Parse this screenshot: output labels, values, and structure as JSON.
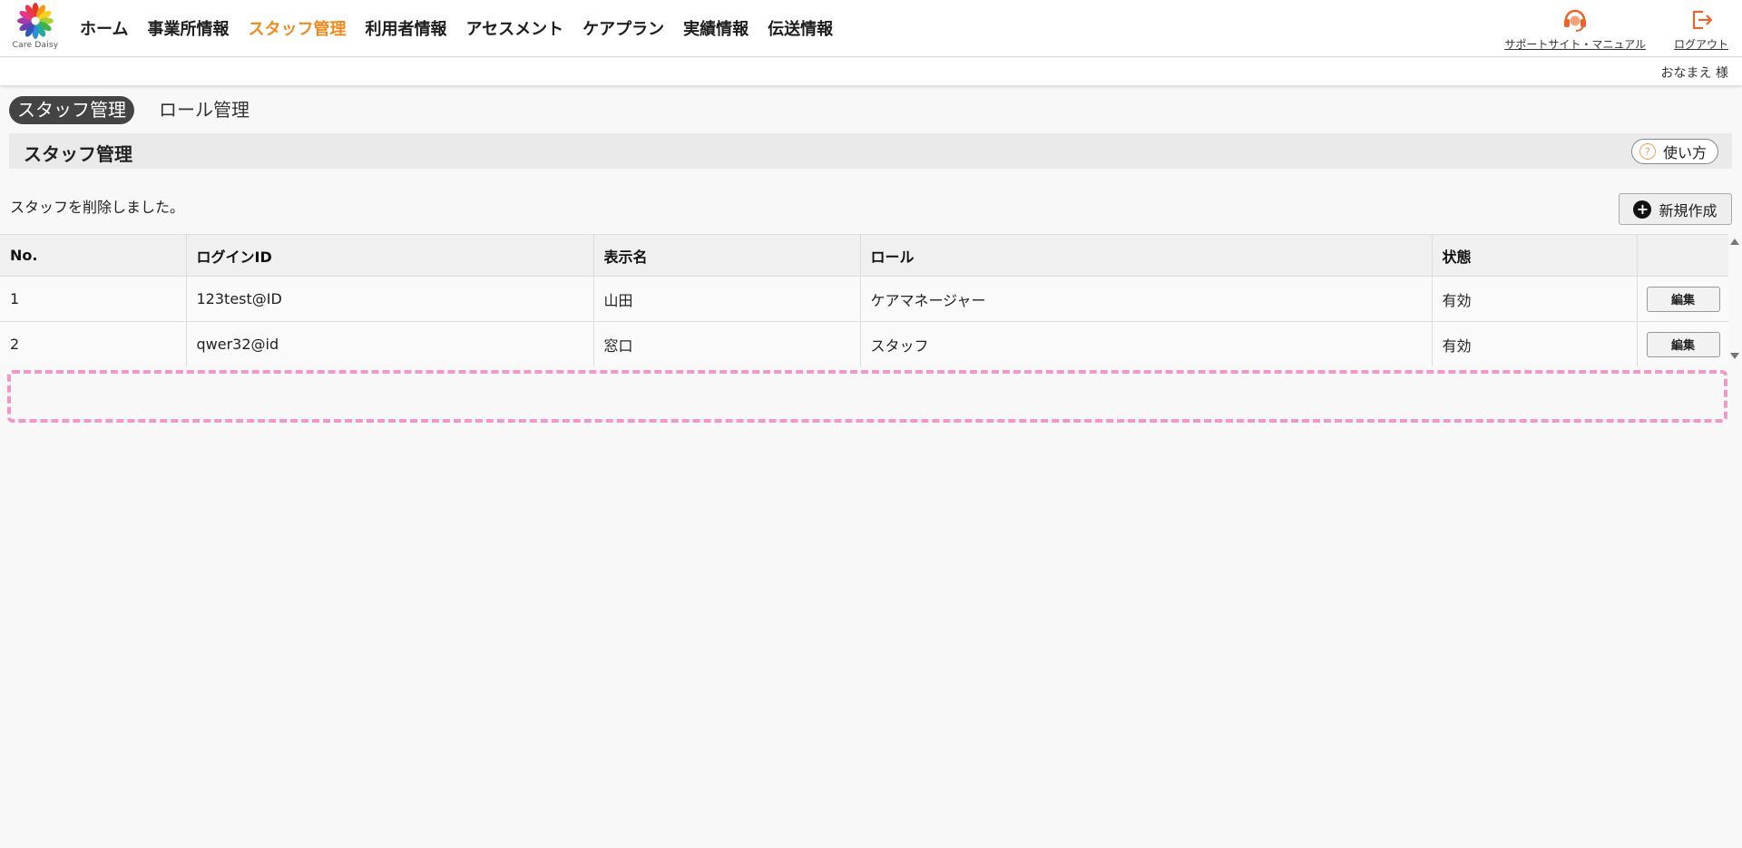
{
  "header": {
    "logo_text": "Care Daisy",
    "nav": [
      "ホーム",
      "事業所情報",
      "スタッフ管理",
      "利用者情報",
      "アセスメント",
      "ケアプラン",
      "実績情報",
      "伝送情報"
    ],
    "active_nav": "スタッフ管理",
    "support_label": "サポートサイト・マニュアル",
    "logout_label": "ログアウト",
    "user_name": "おなまえ 様"
  },
  "tabs": {
    "staff": "スタッフ管理",
    "role": "ロール管理"
  },
  "section": {
    "title": "スタッフ管理",
    "help_label": "使い方"
  },
  "message": "スタッフを削除しました。",
  "new_button_label": "新規作成",
  "table": {
    "headers": [
      "No.",
      "ログインID",
      "表示名",
      "ロール",
      "状態",
      ""
    ],
    "rows": [
      {
        "no": "1",
        "login_id": "123test@ID",
        "display_name": "山田",
        "role": "ケアマネージャー",
        "status": "有効",
        "action": "編集"
      },
      {
        "no": "2",
        "login_id": "qwer32@id",
        "display_name": "窓口",
        "role": "スタッフ",
        "status": "有効",
        "action": "編集"
      }
    ]
  },
  "colors": {
    "accent": "#f08a1c",
    "dropzone": "#ee99c8",
    "tab_active_bg": "#444444"
  }
}
